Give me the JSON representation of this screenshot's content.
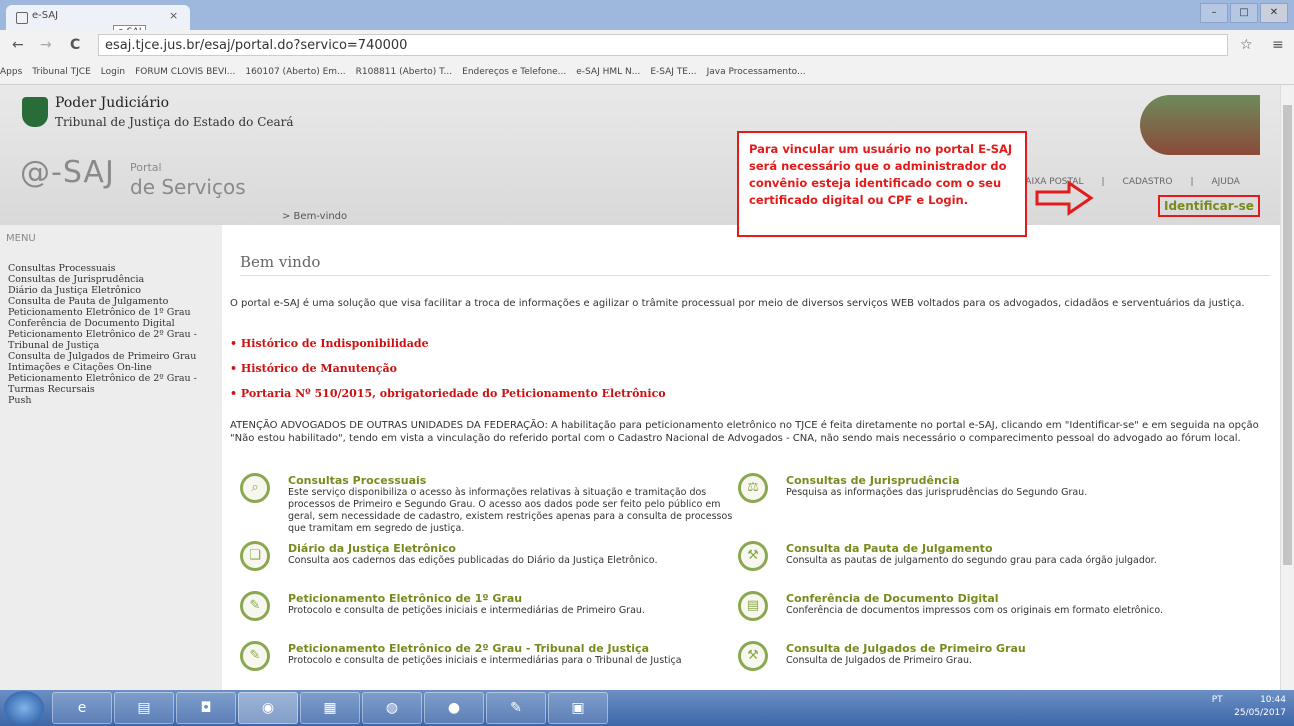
{
  "browser": {
    "tab_title": "e-SAJ",
    "tab_close": "×",
    "tooltip": "e-SAJ",
    "address": "esaj.tjce.jus.br/esaj/portal.do?servico=740000",
    "nav_back": "←",
    "nav_forward": "→",
    "nav_reload": "C",
    "star": "☆",
    "menu": "≡",
    "bookmarks": [
      "Apps",
      "Tribunal TJCE",
      "Login",
      "FORUM CLOVIS BEVI...",
      "160107 (Aberto) Em...",
      "R108811 (Aberto) T...",
      "Endereços e Telefone...",
      "e-SAJ HML N...",
      "E-SAJ TE...",
      "Java Processamento..."
    ],
    "win_min": "–",
    "win_max": "□",
    "win_close": "✕"
  },
  "header": {
    "org_title": "Poder Judiciário",
    "org_subtitle": "Tribunal de Justiça do Estado do Ceará",
    "logo_main": "@-SAJ",
    "logo_portal": "Portal",
    "logo_servicos": "de Serviços",
    "links": [
      "CAIXA POSTAL",
      "|",
      "CADASTRO",
      "|",
      "AJUDA"
    ],
    "identify": "Identificar-se",
    "breadcrumb": "> Bem-vindo"
  },
  "callout": {
    "text": "Para vincular um usuário no portal E-SAJ será necessário que o administrador do convênio esteja identificado com o seu certificado  digital ou CPF e Login."
  },
  "menu": {
    "title": "MENU",
    "items": [
      "Consultas Processuais",
      "Consultas de Jurisprudência",
      "Diário da Justiça Eletrônico",
      "Consulta de Pauta de Julgamento",
      "Peticionamento Eletrônico de 1º Grau",
      "Conferência de Documento Digital",
      "Peticionamento Eletrônico de 2º Grau - Tribunal de Justiça",
      "Consulta de Julgados de Primeiro Grau",
      "Intimações e Citações On-line",
      "Peticionamento Eletrônico de 2º Grau - Turmas Recursais",
      "Push"
    ]
  },
  "main": {
    "welcome": "Bem vindo",
    "intro": "O portal e-SAJ é uma solução que visa facilitar a troca de informações e agilizar o trâmite processual por meio de diversos serviços WEB voltados para os advogados, cidadãos e serventuários da justiça.",
    "red_links": [
      "Histórico de Indisponibilidade",
      "Histórico de Manutenção",
      "Portaria Nº 510/2015, obrigatoriedade do Peticionamento Eletrônico"
    ],
    "atencao": "ATENÇÃO ADVOGADOS DE OUTRAS UNIDADES DA FEDERAÇÃO: A habilitação para peticionamento eletrônico no TJCE é feita diretamente no portal e-SAJ, clicando em \"Identificar-se\" e em seguida na opção \"Não estou habilitado\", tendo em vista a vinculação do referido portal com o Cadastro Nacional de Advogados - CNA, não sendo mais necessário o comparecimento pessoal do advogado ao fórum local.",
    "services": [
      {
        "title": "Consultas Processuais",
        "desc": "Este serviço disponibiliza o acesso às informações relativas à situação e tramitação dos processos de Primeiro e Segundo Grau. O acesso aos dados pode ser feito pelo público em geral, sem necessidade de cadastro, existem restrições apenas para a consulta de processos que tramitam em segredo de justiça.",
        "icon": "magnifier-icon"
      },
      {
        "title": "Consultas de Jurisprudência",
        "desc": "Pesquisa as informações das jurisprudências do Segundo Grau.",
        "icon": "scales-icon"
      },
      {
        "title": "Diário da Justiça Eletrônico",
        "desc": "Consulta aos cadernos das edições publicadas do Diário da Justiça Eletrônico.",
        "icon": "book-icon"
      },
      {
        "title": "Consulta da Pauta de Julgamento",
        "desc": "Consulta as pautas de julgamento do segundo grau para cada órgão julgador.",
        "icon": "gavel-icon"
      },
      {
        "title": "Peticionamento Eletrônico de 1º Grau",
        "desc": "Protocolo e consulta de petições iniciais e intermediárias de Primeiro Grau.",
        "icon": "document-icon"
      },
      {
        "title": "Conferência de Documento Digital",
        "desc": "Conferência de documentos impressos com os originais em formato eletrônico.",
        "icon": "file-check-icon"
      },
      {
        "title": "Peticionamento Eletrônico de 2º Grau - Tribunal de Justiça",
        "desc": "Protocolo e consulta de petições iniciais e intermediárias para o Tribunal de Justiça",
        "icon": "document-icon"
      },
      {
        "title": "Consulta de Julgados de Primeiro Grau",
        "desc": "Consulta de Julgados de Primeiro Grau.",
        "icon": "gavel-icon"
      }
    ]
  },
  "taskbar": {
    "time": "10:44",
    "date": "25/05/2017",
    "lang": "PT"
  }
}
